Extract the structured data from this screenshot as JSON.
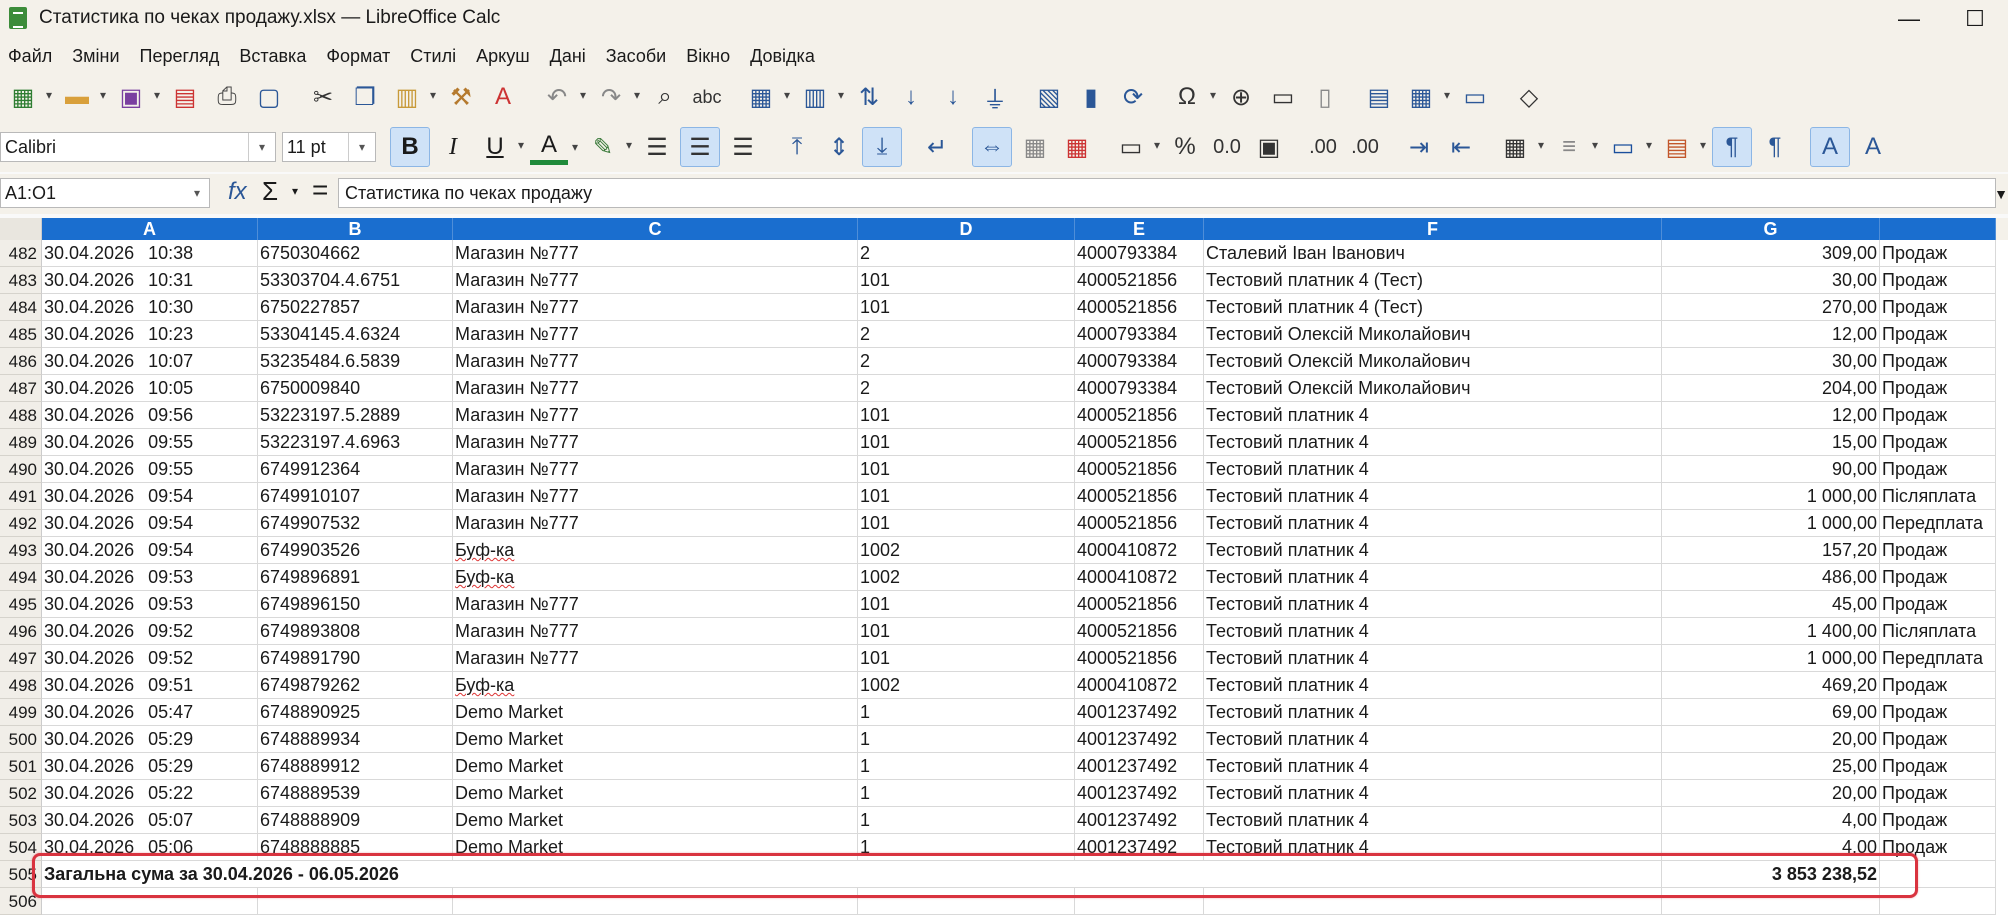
{
  "window": {
    "title": "Статистика по чеках продажу.xlsx — LibreOffice Calc",
    "minimize_glyph": "—",
    "maximize_glyph": "☐"
  },
  "menu": [
    "Файл",
    "Зміни",
    "Перегляд",
    "Вставка",
    "Формат",
    "Стилі",
    "Аркуш",
    "Дані",
    "Засоби",
    "Вікно",
    "Довідка"
  ],
  "font": {
    "name": "Calibri",
    "size": "11 pt"
  },
  "format_toolbar": {
    "bold": "B",
    "italic": "I",
    "underline": "U",
    "font_color": "A",
    "percent": "%",
    "number": "0.0",
    "add_decimal": ".00",
    "del_decimal": ".00"
  },
  "formula_bar": {
    "name_box": "A1:O1",
    "fx": "fx",
    "sigma": "Σ",
    "equals": "=",
    "content": "Статистика по чеках продажу"
  },
  "columns": [
    "A",
    "B",
    "C",
    "D",
    "E",
    "F",
    "G"
  ],
  "rows": [
    {
      "n": "482",
      "date": "30.04.2026",
      "time": "10:38",
      "receipt": "6750304662",
      "shop": "Магазин №777",
      "d": "2",
      "e": "4000793384",
      "f": "Сталевий Іван Іванович",
      "amount": "309,00",
      "type": "Продаж"
    },
    {
      "n": "483",
      "date": "30.04.2026",
      "time": "10:31",
      "receipt": "53303704.4.6751",
      "shop": "Магазин №777",
      "d": "101",
      "e": "4000521856",
      "f": "Тестовий платник 4 (Тест)",
      "amount": "30,00",
      "type": "Продаж"
    },
    {
      "n": "484",
      "date": "30.04.2026",
      "time": "10:30",
      "receipt": "6750227857",
      "shop": "Магазин №777",
      "d": "101",
      "e": "4000521856",
      "f": "Тестовий платник 4 (Тест)",
      "amount": "270,00",
      "type": "Продаж"
    },
    {
      "n": "485",
      "date": "30.04.2026",
      "time": "10:23",
      "receipt": "53304145.4.6324",
      "shop": "Магазин №777",
      "d": "2",
      "e": "4000793384",
      "f": "Тестовий Олексій Миколайович",
      "amount": "12,00",
      "type": "Продаж"
    },
    {
      "n": "486",
      "date": "30.04.2026",
      "time": "10:07",
      "receipt": "53235484.6.5839",
      "shop": "Магазин №777",
      "d": "2",
      "e": "4000793384",
      "f": "Тестовий Олексій Миколайович",
      "amount": "30,00",
      "type": "Продаж"
    },
    {
      "n": "487",
      "date": "30.04.2026",
      "time": "10:05",
      "receipt": "6750009840",
      "shop": "Магазин №777",
      "d": "2",
      "e": "4000793384",
      "f": "Тестовий Олексій Миколайович",
      "amount": "204,00",
      "type": "Продаж"
    },
    {
      "n": "488",
      "date": "30.04.2026",
      "time": "09:56",
      "receipt": "53223197.5.2889",
      "shop": "Магазин №777",
      "d": "101",
      "e": "4000521856",
      "f": "Тестовий платник 4",
      "amount": "12,00",
      "type": "Продаж"
    },
    {
      "n": "489",
      "date": "30.04.2026",
      "time": "09:55",
      "receipt": "53223197.4.6963",
      "shop": "Магазин №777",
      "d": "101",
      "e": "4000521856",
      "f": "Тестовий платник 4",
      "amount": "15,00",
      "type": "Продаж"
    },
    {
      "n": "490",
      "date": "30.04.2026",
      "time": "09:55",
      "receipt": "6749912364",
      "shop": "Магазин №777",
      "d": "101",
      "e": "4000521856",
      "f": "Тестовий платник 4",
      "amount": "90,00",
      "type": "Продаж"
    },
    {
      "n": "491",
      "date": "30.04.2026",
      "time": "09:54",
      "receipt": "6749910107",
      "shop": "Магазин №777",
      "d": "101",
      "e": "4000521856",
      "f": "Тестовий платник 4",
      "amount": "1 000,00",
      "type": "Післяплата"
    },
    {
      "n": "492",
      "date": "30.04.2026",
      "time": "09:54",
      "receipt": "6749907532",
      "shop": "Магазин №777",
      "d": "101",
      "e": "4000521856",
      "f": "Тестовий платник 4",
      "amount": "1 000,00",
      "type": "Передплата"
    },
    {
      "n": "493",
      "date": "30.04.2026",
      "time": "09:54",
      "receipt": "6749903526",
      "shop": "Буф-ка",
      "d": "1002",
      "e": "4000410872",
      "f": "Тестовий платник 4",
      "amount": "157,20",
      "type": "Продаж"
    },
    {
      "n": "494",
      "date": "30.04.2026",
      "time": "09:53",
      "receipt": "6749896891",
      "shop": "Буф-ка",
      "d": "1002",
      "e": "4000410872",
      "f": "Тестовий платник 4",
      "amount": "486,00",
      "type": "Продаж"
    },
    {
      "n": "495",
      "date": "30.04.2026",
      "time": "09:53",
      "receipt": "6749896150",
      "shop": "Магазин №777",
      "d": "101",
      "e": "4000521856",
      "f": "Тестовий платник 4",
      "amount": "45,00",
      "type": "Продаж"
    },
    {
      "n": "496",
      "date": "30.04.2026",
      "time": "09:52",
      "receipt": "6749893808",
      "shop": "Магазин №777",
      "d": "101",
      "e": "4000521856",
      "f": "Тестовий платник 4",
      "amount": "1 400,00",
      "type": "Післяплата"
    },
    {
      "n": "497",
      "date": "30.04.2026",
      "time": "09:52",
      "receipt": "6749891790",
      "shop": "Магазин №777",
      "d": "101",
      "e": "4000521856",
      "f": "Тестовий платник 4",
      "amount": "1 000,00",
      "type": "Передплата"
    },
    {
      "n": "498",
      "date": "30.04.2026",
      "time": "09:51",
      "receipt": "6749879262",
      "shop": "Буф-ка",
      "d": "1002",
      "e": "4000410872",
      "f": "Тестовий платник 4",
      "amount": "469,20",
      "type": "Продаж"
    },
    {
      "n": "499",
      "date": "30.04.2026",
      "time": "05:47",
      "receipt": "6748890925",
      "shop": "Demo Market",
      "d": "1",
      "e": "4001237492",
      "f": "Тестовий платник 4",
      "amount": "69,00",
      "type": "Продаж"
    },
    {
      "n": "500",
      "date": "30.04.2026",
      "time": "05:29",
      "receipt": "6748889934",
      "shop": "Demo Market",
      "d": "1",
      "e": "4001237492",
      "f": "Тестовий платник 4",
      "amount": "20,00",
      "type": "Продаж"
    },
    {
      "n": "501",
      "date": "30.04.2026",
      "time": "05:29",
      "receipt": "6748889912",
      "shop": "Demo Market",
      "d": "1",
      "e": "4001237492",
      "f": "Тестовий платник 4",
      "amount": "25,00",
      "type": "Продаж"
    },
    {
      "n": "502",
      "date": "30.04.2026",
      "time": "05:22",
      "receipt": "6748889539",
      "shop": "Demo Market",
      "d": "1",
      "e": "4001237492",
      "f": "Тестовий платник 4",
      "amount": "20,00",
      "type": "Продаж"
    },
    {
      "n": "503",
      "date": "30.04.2026",
      "time": "05:07",
      "receipt": "6748888909",
      "shop": "Demo Market",
      "d": "1",
      "e": "4001237492",
      "f": "Тестовий платник 4",
      "amount": "4,00",
      "type": "Продаж"
    },
    {
      "n": "504",
      "date": "30.04.2026",
      "time": "05:06",
      "receipt": "6748888885",
      "shop": "Demo Market",
      "d": "1",
      "e": "4001237492",
      "f": "Тестовий платник 4",
      "amount": "4,00",
      "type": "Продаж"
    }
  ],
  "total_row": {
    "n": "505",
    "label": "Загальна сума за 30.04.2026 - 06.05.2026",
    "amount": "3 853 238,52"
  },
  "empty_row": {
    "n": "506"
  },
  "colors": {
    "header_blue": "#1a6ecf",
    "highlight_red": "#d9333f",
    "spell_red": "#d33"
  }
}
